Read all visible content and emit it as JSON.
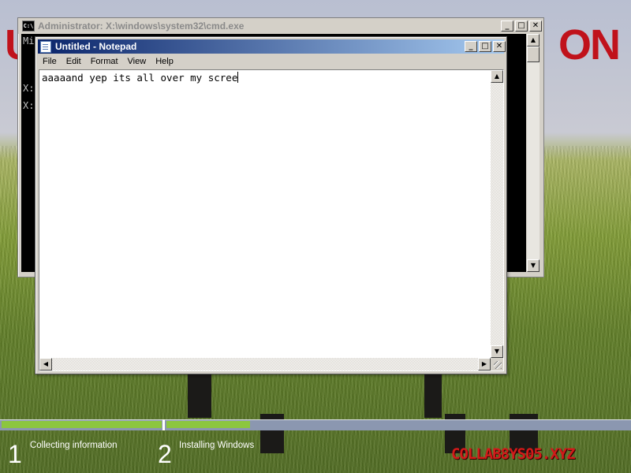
{
  "cmd": {
    "title": "Administrator: X:\\windows\\system32\\cmd.exe",
    "icon_text": "C:\\",
    "lines": [
      "Mi",
      "X:",
      "X:"
    ]
  },
  "notepad": {
    "title": "Untitled - Notepad",
    "menu": [
      "File",
      "Edit",
      "Format",
      "View",
      "Help"
    ],
    "content": "aaaaand yep its all over my scree"
  },
  "window_buttons": {
    "minimize": "_",
    "maximize": "□",
    "close": "✕"
  },
  "setup": {
    "steps": [
      {
        "number": "1",
        "label": "Collecting information"
      },
      {
        "number": "2",
        "label": "Installing Windows"
      }
    ]
  },
  "background": {
    "letters_left": "U",
    "letters_right": "ON",
    "brand": "COLLAB8YS05.XYZ"
  },
  "colors": {
    "progress_fill": "#8cc63f",
    "progress_track": "#8b97b0",
    "notepad_title_start": "#0a246a",
    "notepad_title_end": "#a6caf0",
    "brand_red": "#d21a1a"
  }
}
